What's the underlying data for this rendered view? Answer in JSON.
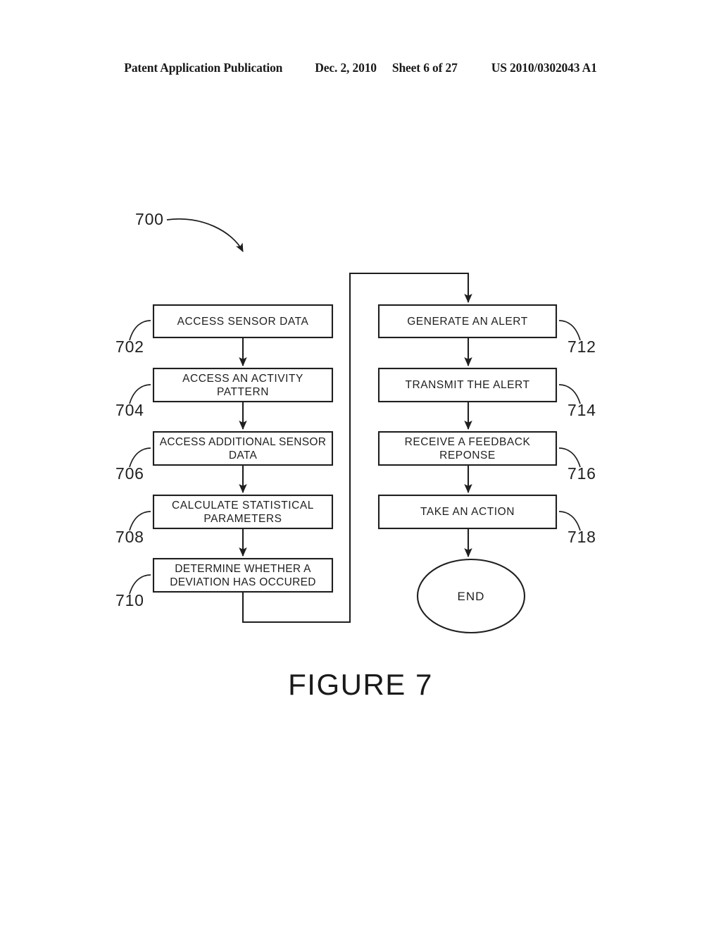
{
  "header": {
    "publication": "Patent Application Publication",
    "date": "Dec. 2, 2010",
    "sheet": "Sheet 6 of 27",
    "patent_number": "US 2010/0302043 A1"
  },
  "figure": {
    "caption": "FIGURE 7",
    "diagram_ref": "700",
    "terminator_label": "END"
  },
  "flowchart": {
    "type": "flowchart",
    "left_column": [
      {
        "ref": "702",
        "label": "ACCESS SENSOR DATA"
      },
      {
        "ref": "704",
        "label": "ACCESS AN ACTIVITY PATTERN"
      },
      {
        "ref": "706",
        "label": "ACCESS ADDITIONAL SENSOR DATA"
      },
      {
        "ref": "708",
        "label": "CALCULATE STATISTICAL PARAMETERS"
      },
      {
        "ref": "710",
        "label": "DETERMINE WHETHER A DEVIATION HAS OCCURED"
      }
    ],
    "right_column": [
      {
        "ref": "712",
        "label": "GENERATE AN ALERT"
      },
      {
        "ref": "714",
        "label": "TRANSMIT THE ALERT"
      },
      {
        "ref": "716",
        "label": "RECEIVE A FEEDBACK REPONSE"
      },
      {
        "ref": "718",
        "label": "TAKE AN ACTION"
      }
    ],
    "steps_text": {
      "s702_line1": "ACCESS SENSOR DATA",
      "s704_line1": "ACCESS AN ACTIVITY",
      "s704_line2": "PATTERN",
      "s706_line1": "ACCESS ADDITIONAL SENSOR",
      "s706_line2": "DATA",
      "s708_line1": "CALCULATE STATISTICAL",
      "s708_line2": "PARAMETERS",
      "s710_line1": "DETERMINE WHETHER A",
      "s710_line2": "DEVIATION HAS OCCURED",
      "s712_line1": "GENERATE AN ALERT",
      "s714_line1": "TRANSMIT THE ALERT",
      "s716_line1": "RECEIVE A FEEDBACK",
      "s716_line2": "REPONSE",
      "s718_line1": "TAKE AN ACTION"
    }
  },
  "colors": {
    "ink": "#1f1f1f",
    "paper": "#ffffff"
  }
}
